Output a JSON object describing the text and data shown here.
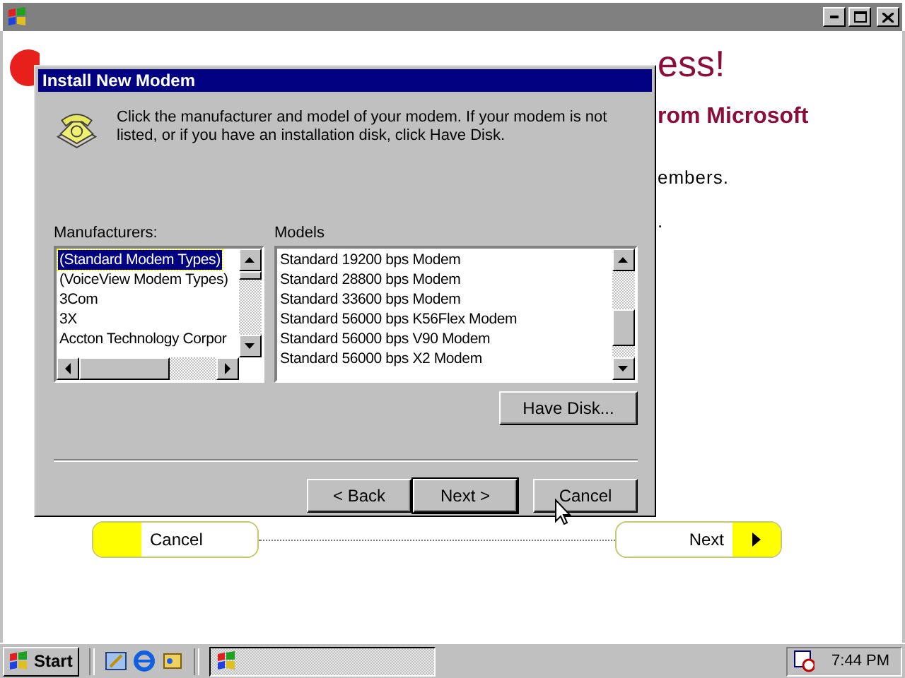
{
  "page": {
    "texts": [
      {
        "kind": "heading",
        "text": "ess!"
      },
      {
        "kind": "subheading",
        "text": "rom Microsoft"
      },
      {
        "kind": "body",
        "text": "embers."
      },
      {
        "kind": "body",
        "text": "."
      }
    ]
  },
  "wizard_buttons": [
    {
      "kind": "back",
      "label": "Cancel"
    },
    {
      "kind": "forward",
      "label": "Next"
    }
  ],
  "dialog": {
    "title": "Install New Modem",
    "instructions": "Click the manufacturer and model of your modem. If your modem is not listed, or if you have an installation disk, click Have Disk.",
    "manufacturers": {
      "label": "Manufacturers:",
      "items": [
        {
          "label": "(Standard Modem Types)",
          "selected": true
        },
        {
          "label": "(VoiceView Modem Types)",
          "selected": false
        },
        {
          "label": "3Com",
          "selected": false
        },
        {
          "label": "3X",
          "selected": false
        },
        {
          "label": "Accton Technology Corpor",
          "selected": false
        }
      ]
    },
    "models": {
      "label": "Models",
      "items": [
        {
          "label": "Standard 19200 bps Modem",
          "selected": false
        },
        {
          "label": "Standard 28800 bps Modem",
          "selected": false
        },
        {
          "label": "Standard 33600 bps Modem",
          "selected": false
        },
        {
          "label": "Standard 56000 bps K56Flex Modem",
          "selected": false
        },
        {
          "label": "Standard 56000 bps V90 Modem",
          "selected": false
        },
        {
          "label": "Standard 56000 bps X2 Modem",
          "selected": false
        }
      ]
    },
    "have_disk": "Have Disk...",
    "buttons": [
      {
        "label": "< Back",
        "default": false
      },
      {
        "label": "Next >",
        "default": true
      },
      {
        "label": "Cancel",
        "default": false
      }
    ]
  },
  "taskbar": {
    "start": "Start",
    "clock": "7:44 PM"
  }
}
